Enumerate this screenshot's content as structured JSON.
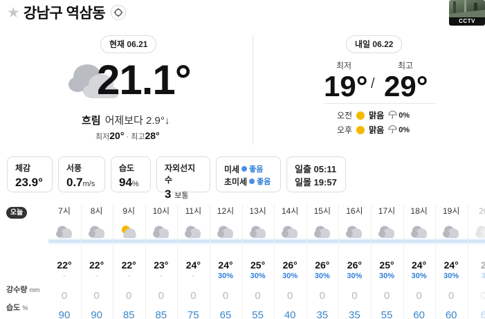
{
  "header": {
    "location": "강남구 역삼동",
    "star_icon": "star-icon",
    "target_icon": "crosshair-icon",
    "cctv_label": "CCTV"
  },
  "today": {
    "pill": "현재 06.21",
    "temp": "21.1°",
    "condition": "흐림",
    "compare": "어제보다 2.9°↓",
    "min_label": "최저",
    "min": "20°",
    "max_label": "최고",
    "max": "28°",
    "icon": "cloud-icon"
  },
  "tomorrow": {
    "pill": "내일 06.22",
    "min_label": "최저",
    "max_label": "최고",
    "min": "19°",
    "slash": "/",
    "max": "29°",
    "am": {
      "label": "오전",
      "condition": "맑음",
      "precip": "0%"
    },
    "pm": {
      "label": "오후",
      "condition": "맑음",
      "precip": "0%"
    }
  },
  "cards": {
    "feels": {
      "title": "체감",
      "value": "23.9°"
    },
    "wind": {
      "title": "서풍",
      "value": "0.7",
      "unit": "m/s"
    },
    "humidity": {
      "title": "습도",
      "value": "94",
      "unit": "%"
    },
    "uv": {
      "title": "자외선지수",
      "value": "3",
      "unit": "보통"
    },
    "dust": {
      "pm10_label": "미세",
      "pm10_value": "좋음",
      "pm25_label": "초미세",
      "pm25_value": "좋음"
    },
    "sun": {
      "rise_label": "일출",
      "rise": "05:11",
      "set_label": "일몰",
      "set": "19:57"
    }
  },
  "hourly": {
    "badge": "오늘",
    "rain_label": "강수량",
    "rain_unit": "mm",
    "hum_label": "습도",
    "hum_unit": "%",
    "hours": [
      {
        "time": "7시",
        "icon": "cloud-icon",
        "temp": "22°",
        "pop": "-",
        "rain": "0",
        "hum": "90"
      },
      {
        "time": "8시",
        "icon": "cloud-icon",
        "temp": "22°",
        "pop": "-",
        "rain": "0",
        "hum": "90"
      },
      {
        "time": "9시",
        "icon": "partly-cloudy-icon",
        "temp": "22°",
        "pop": "-",
        "rain": "0",
        "hum": "85"
      },
      {
        "time": "10시",
        "icon": "cloud-icon",
        "temp": "23°",
        "pop": "-",
        "rain": "0",
        "hum": "85"
      },
      {
        "time": "11시",
        "icon": "cloud-icon",
        "temp": "24°",
        "pop": "-",
        "rain": "0",
        "hum": "75"
      },
      {
        "time": "12시",
        "icon": "cloud-icon",
        "temp": "24°",
        "pop": "30%",
        "rain": "0",
        "hum": "65"
      },
      {
        "time": "13시",
        "icon": "cloud-icon",
        "temp": "25°",
        "pop": "30%",
        "rain": "0",
        "hum": "55"
      },
      {
        "time": "14시",
        "icon": "cloud-icon",
        "temp": "26°",
        "pop": "30%",
        "rain": "0",
        "hum": "40"
      },
      {
        "time": "15시",
        "icon": "cloud-icon",
        "temp": "26°",
        "pop": "30%",
        "rain": "0",
        "hum": "35"
      },
      {
        "time": "16시",
        "icon": "cloud-icon",
        "temp": "26°",
        "pop": "30%",
        "rain": "0",
        "hum": "35"
      },
      {
        "time": "17시",
        "icon": "cloud-icon",
        "temp": "25°",
        "pop": "30%",
        "rain": "0",
        "hum": "55"
      },
      {
        "time": "18시",
        "icon": "cloud-icon",
        "temp": "24°",
        "pop": "30%",
        "rain": "0",
        "hum": "60"
      },
      {
        "time": "19시",
        "icon": "cloud-icon",
        "temp": "24°",
        "pop": "30%",
        "rain": "0",
        "hum": "60"
      },
      {
        "time": "20",
        "icon": "cloud-icon",
        "temp": "2",
        "pop": "3",
        "rain": "0",
        "hum": "6"
      }
    ]
  },
  "colors": {
    "accent_blue": "#2f7fd9",
    "humidity_blue": "#3a86c8",
    "sun_yellow": "#f5b800"
  }
}
